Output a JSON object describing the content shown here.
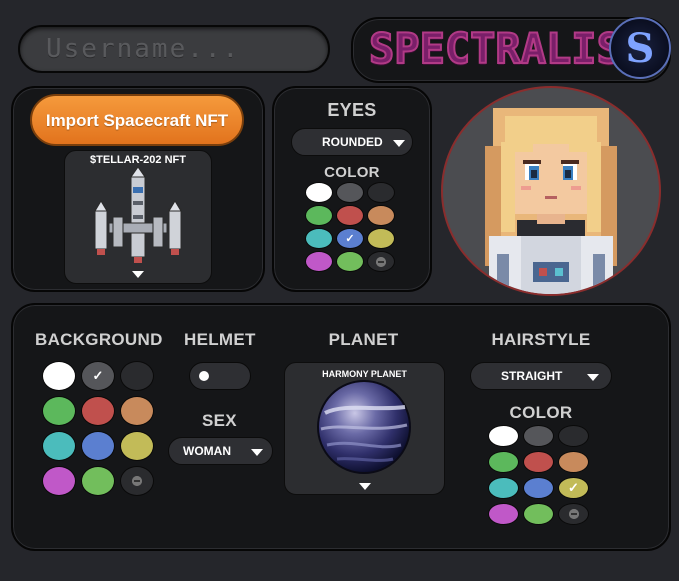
{
  "username": {
    "placeholder": "Username..."
  },
  "logo": {
    "text": "SPECTRALIS",
    "badge": "S"
  },
  "import": {
    "label": "Import Spacecraft NFT",
    "nft_name": "$TELLAR-202 NFT"
  },
  "eyes": {
    "heading": "EYES",
    "selected": "ROUNDED",
    "color_heading": "COLOR"
  },
  "background": {
    "heading": "BACKGROUND"
  },
  "helmet": {
    "heading": "HELMET"
  },
  "sex": {
    "heading": "SEX",
    "selected": "WOMAN"
  },
  "planet": {
    "heading": "PLANET",
    "name": "HARMONY PLANET"
  },
  "hairstyle": {
    "heading": "HAIRSTYLE",
    "selected": "STRAIGHT",
    "color_heading": "COLOR"
  },
  "colors": {
    "white": "#ffffff",
    "gray": "#55565a",
    "dark": "#2a2b2e",
    "green": "#5cb85c",
    "red": "#c0504d",
    "tan": "#c88a5c",
    "teal": "#4bbcbc",
    "blue": "#5b7fd0",
    "olive": "#c2bb58",
    "magenta": "#c058c8",
    "lime": "#72be5c",
    "orange_button": "#e98a2a"
  },
  "selected_swatches": {
    "eyes": "blue",
    "background": "gray",
    "hair": "olive"
  },
  "icons": [
    "caret-down-icon",
    "checkmark-icon",
    "no-color-icon",
    "spaceship-image",
    "planet-image",
    "avatar-image"
  ]
}
